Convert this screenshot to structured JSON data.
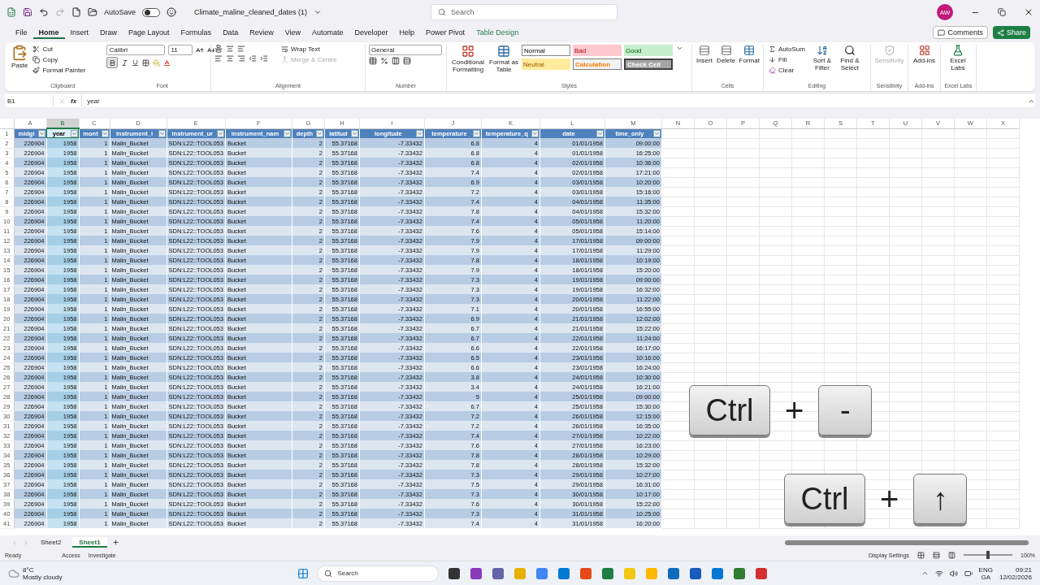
{
  "titlebar": {
    "autosave_label": "AutoSave",
    "autosave_on": false,
    "filename": "Climate_maline_cleaned_dates (1)",
    "search_placeholder": "Search",
    "avatar": "AW"
  },
  "menu_tabs": [
    {
      "label": "File",
      "selected": false,
      "kind": "normal"
    },
    {
      "label": "Home",
      "selected": true,
      "kind": "normal"
    },
    {
      "label": "Insert",
      "selected": false,
      "kind": "normal"
    },
    {
      "label": "Draw",
      "selected": false,
      "kind": "normal"
    },
    {
      "label": "Page Layout",
      "selected": false,
      "kind": "normal"
    },
    {
      "label": "Formulas",
      "selected": false,
      "kind": "normal"
    },
    {
      "label": "Data",
      "selected": false,
      "kind": "normal"
    },
    {
      "label": "Review",
      "selected": false,
      "kind": "normal"
    },
    {
      "label": "View",
      "selected": false,
      "kind": "normal"
    },
    {
      "label": "Automate",
      "selected": false,
      "kind": "normal"
    },
    {
      "label": "Developer",
      "selected": false,
      "kind": "normal"
    },
    {
      "label": "Help",
      "selected": false,
      "kind": "normal"
    },
    {
      "label": "Power Pivot",
      "selected": false,
      "kind": "normal"
    },
    {
      "label": "Table Design",
      "selected": false,
      "kind": "contextual"
    }
  ],
  "comments": "Comments",
  "share": "Share",
  "ribbon": {
    "clipboard": {
      "paste": "Paste",
      "cut": "Cut",
      "copy": "Copy",
      "format_painter": "Format Painter",
      "title": "Clipboard"
    },
    "font": {
      "name": "Calibri",
      "size": "11",
      "bold_on": true,
      "title": "Font"
    },
    "alignment": {
      "wrap": "Wrap Text",
      "merge": "Merge & Centre",
      "title": "Alignment"
    },
    "number": {
      "format": "General",
      "title": "Number"
    },
    "styles": {
      "conditional": "Conditional Formatting",
      "format_table": "Format as Table",
      "cells": [
        {
          "label": "Normal",
          "kind": "normal"
        },
        {
          "label": "Bad",
          "kind": "bad"
        },
        {
          "label": "Good",
          "kind": "good"
        },
        {
          "label": "Neutral",
          "kind": "neutral"
        },
        {
          "label": "Calculation",
          "kind": "calculation"
        },
        {
          "label": "Check Cell",
          "kind": "check"
        }
      ],
      "title": "Styles"
    },
    "cells": {
      "insert": "Insert",
      "delete": "Delete",
      "format": "Format",
      "title": "Cells"
    },
    "editing": {
      "autosum": "AutoSum",
      "fill": "Fill",
      "clear": "Clear",
      "sort": "Sort & Filter",
      "find": "Find & Select",
      "title": "Editing"
    },
    "sensitivity": {
      "label": "Sensitivity",
      "title": "Sensitivity"
    },
    "addins": {
      "label": "Add-ins",
      "title": "Add-ins"
    },
    "labs": {
      "label": "Excel Labs",
      "title": "Excel Labs"
    }
  },
  "formula_bar": {
    "cell": "B1",
    "fx": "fx",
    "value": "year"
  },
  "sheet": {
    "corner_row": "1",
    "columns": [
      {
        "label": "A",
        "selected": false
      },
      {
        "label": "B",
        "selected": true
      },
      {
        "label": "C",
        "selected": false
      },
      {
        "label": "D",
        "selected": false
      },
      {
        "label": "E",
        "selected": false
      },
      {
        "label": "F",
        "selected": false
      },
      {
        "label": "G",
        "selected": false
      },
      {
        "label": "H",
        "selected": false
      },
      {
        "label": "I",
        "selected": false
      },
      {
        "label": "J",
        "selected": false
      },
      {
        "label": "K",
        "selected": false
      },
      {
        "label": "L",
        "selected": false
      },
      {
        "label": "M",
        "selected": false
      },
      {
        "label": "N",
        "selected": false
      },
      {
        "label": "O",
        "selected": false
      },
      {
        "label": "P",
        "selected": false
      },
      {
        "label": "Q",
        "selected": false
      },
      {
        "label": "R",
        "selected": false
      },
      {
        "label": "S",
        "selected": false
      },
      {
        "label": "T",
        "selected": false
      },
      {
        "label": "U",
        "selected": false
      },
      {
        "label": "V",
        "selected": false
      },
      {
        "label": "W",
        "selected": false
      },
      {
        "label": "X",
        "selected": false
      }
    ],
    "headers": [
      "midgi",
      "year",
      "mont",
      "instrument_i",
      "instrument_ur",
      "instrument_nam",
      "depth",
      "latitud",
      "longitude",
      "temperature",
      "temperature_q",
      "date",
      "time_only"
    ],
    "rows": [
      {
        "n": "2",
        "cells": [
          "226904",
          "1958",
          "1",
          "Malin_Bucket",
          "SDN:L22::TOOL053",
          "Bucket",
          "2",
          "55.37168",
          "-7.33432",
          "6.8",
          "4",
          "01/01/1958",
          "09:00:00"
        ]
      },
      {
        "n": "3",
        "cells": [
          "226904",
          "1958",
          "1",
          "Malin_Bucket",
          "SDN:L22::TOOL053",
          "Bucket",
          "2",
          "55.37168",
          "-7.33432",
          "6.8",
          "4",
          "01/01/1958",
          "16:25:00"
        ]
      },
      {
        "n": "4",
        "cells": [
          "226904",
          "1958",
          "1",
          "Malin_Bucket",
          "SDN:L22::TOOL053",
          "Bucket",
          "2",
          "55.37168",
          "-7.33432",
          "6.8",
          "4",
          "02/01/1958",
          "10:36:00"
        ]
      },
      {
        "n": "5",
        "cells": [
          "226904",
          "1958",
          "1",
          "Malin_Bucket",
          "SDN:L22::TOOL053",
          "Bucket",
          "2",
          "55.37168",
          "-7.33432",
          "7.4",
          "4",
          "02/01/1958",
          "17:21:00"
        ]
      },
      {
        "n": "6",
        "cells": [
          "226904",
          "1958",
          "1",
          "Malin_Bucket",
          "SDN:L22::TOOL053",
          "Bucket",
          "2",
          "55.37168",
          "-7.33432",
          "6.9",
          "4",
          "03/01/1958",
          "10:20:00"
        ]
      },
      {
        "n": "7",
        "cells": [
          "226904",
          "1958",
          "1",
          "Malin_Bucket",
          "SDN:L22::TOOL053",
          "Bucket",
          "2",
          "55.37168",
          "-7.33432",
          "7.2",
          "4",
          "03/01/1958",
          "15:16:00"
        ]
      },
      {
        "n": "8",
        "cells": [
          "226904",
          "1958",
          "1",
          "Malin_Bucket",
          "SDN:L22::TOOL053",
          "Bucket",
          "2",
          "55.37168",
          "-7.33432",
          "7.4",
          "4",
          "04/01/1958",
          "11:35:00"
        ]
      },
      {
        "n": "9",
        "cells": [
          "226904",
          "1958",
          "1",
          "Malin_Bucket",
          "SDN:L22::TOOL053",
          "Bucket",
          "2",
          "55.37168",
          "-7.33432",
          "7.8",
          "4",
          "04/01/1958",
          "15:32:00"
        ]
      },
      {
        "n": "10",
        "cells": [
          "226904",
          "1958",
          "1",
          "Malin_Bucket",
          "SDN:L22::TOOL053",
          "Bucket",
          "2",
          "55.37168",
          "-7.33432",
          "7.4",
          "4",
          "05/01/1958",
          "11:20:00"
        ]
      },
      {
        "n": "11",
        "cells": [
          "226904",
          "1958",
          "1",
          "Malin_Bucket",
          "SDN:L22::TOOL053",
          "Bucket",
          "2",
          "55.37168",
          "-7.33432",
          "7.6",
          "4",
          "05/01/1958",
          "15:14:00"
        ]
      },
      {
        "n": "12",
        "cells": [
          "226904",
          "1958",
          "1",
          "Malin_Bucket",
          "SDN:L22::TOOL053",
          "Bucket",
          "2",
          "55.37168",
          "-7.33432",
          "7.9",
          "4",
          "17/01/1958",
          "09:00:00"
        ]
      },
      {
        "n": "13",
        "cells": [
          "226904",
          "1958",
          "1",
          "Malin_Bucket",
          "SDN:L22::TOOL053",
          "Bucket",
          "2",
          "55.37168",
          "-7.33432",
          "7.9",
          "4",
          "17/01/1958",
          "11:29:00"
        ]
      },
      {
        "n": "14",
        "cells": [
          "226904",
          "1958",
          "1",
          "Malin_Bucket",
          "SDN:L22::TOOL053",
          "Bucket",
          "2",
          "55.37168",
          "-7.33432",
          "7.8",
          "4",
          "18/01/1958",
          "10:19:00"
        ]
      },
      {
        "n": "15",
        "cells": [
          "226904",
          "1958",
          "1",
          "Malin_Bucket",
          "SDN:L22::TOOL053",
          "Bucket",
          "2",
          "55.37168",
          "-7.33432",
          "7.9",
          "4",
          "18/01/1958",
          "15:20:00"
        ]
      },
      {
        "n": "16",
        "cells": [
          "226904",
          "1958",
          "1",
          "Malin_Bucket",
          "SDN:L22::TOOL053",
          "Bucket",
          "2",
          "55.37168",
          "-7.33432",
          "7.3",
          "4",
          "19/01/1958",
          "09:00:00"
        ]
      },
      {
        "n": "17",
        "cells": [
          "226904",
          "1958",
          "1",
          "Malin_Bucket",
          "SDN:L22::TOOL053",
          "Bucket",
          "2",
          "55.37168",
          "-7.33432",
          "7.3",
          "4",
          "19/01/1958",
          "16:32:00"
        ]
      },
      {
        "n": "18",
        "cells": [
          "226904",
          "1958",
          "1",
          "Malin_Bucket",
          "SDN:L22::TOOL053",
          "Bucket",
          "2",
          "55.37168",
          "-7.33432",
          "7.3",
          "4",
          "20/01/1958",
          "11:22:00"
        ]
      },
      {
        "n": "19",
        "cells": [
          "226904",
          "1958",
          "1",
          "Malin_Bucket",
          "SDN:L22::TOOL053",
          "Bucket",
          "2",
          "55.37168",
          "-7.33432",
          "7.1",
          "4",
          "20/01/1958",
          "16:55:00"
        ]
      },
      {
        "n": "20",
        "cells": [
          "226904",
          "1958",
          "1",
          "Malin_Bucket",
          "SDN:L22::TOOL053",
          "Bucket",
          "2",
          "55.37168",
          "-7.33432",
          "6.9",
          "4",
          "21/01/1958",
          "12:02:00"
        ]
      },
      {
        "n": "21",
        "cells": [
          "226904",
          "1958",
          "1",
          "Malin_Bucket",
          "SDN:L22::TOOL053",
          "Bucket",
          "2",
          "55.37168",
          "-7.33432",
          "6.7",
          "4",
          "21/01/1958",
          "15:22:00"
        ]
      },
      {
        "n": "22",
        "cells": [
          "226904",
          "1958",
          "1",
          "Malin_Bucket",
          "SDN:L22::TOOL053",
          "Bucket",
          "2",
          "55.37168",
          "-7.33432",
          "6.7",
          "4",
          "22/01/1958",
          "11:24:00"
        ]
      },
      {
        "n": "23",
        "cells": [
          "226904",
          "1958",
          "1",
          "Malin_Bucket",
          "SDN:L22::TOOL053",
          "Bucket",
          "2",
          "55.37168",
          "-7.33432",
          "6.6",
          "4",
          "22/01/1958",
          "16:17:00"
        ]
      },
      {
        "n": "24",
        "cells": [
          "226904",
          "1958",
          "1",
          "Malin_Bucket",
          "SDN:L22::TOOL053",
          "Bucket",
          "2",
          "55.37168",
          "-7.33432",
          "6.5",
          "4",
          "23/01/1958",
          "10:16:00"
        ]
      },
      {
        "n": "25",
        "cells": [
          "226904",
          "1958",
          "1",
          "Malin_Bucket",
          "SDN:L22::TOOL053",
          "Bucket",
          "2",
          "55.37168",
          "-7.33432",
          "6.6",
          "4",
          "23/01/1958",
          "16:24:00"
        ]
      },
      {
        "n": "26",
        "cells": [
          "226904",
          "1958",
          "1",
          "Malin_Bucket",
          "SDN:L22::TOOL053",
          "Bucket",
          "2",
          "55.37168",
          "-7.33432",
          "3.8",
          "4",
          "24/01/1958",
          "10:30:00"
        ]
      },
      {
        "n": "27",
        "cells": [
          "226904",
          "1958",
          "1",
          "Malin_Bucket",
          "SDN:L22::TOOL053",
          "Bucket",
          "2",
          "55.37168",
          "-7.33432",
          "3.4",
          "4",
          "24/01/1958",
          "16:21:00"
        ]
      },
      {
        "n": "28",
        "cells": [
          "226904",
          "1958",
          "1",
          "Malin_Bucket",
          "SDN:L22::TOOL053",
          "Bucket",
          "2",
          "55.37168",
          "-7.33432",
          "5",
          "4",
          "25/01/1958",
          "09:00:00"
        ]
      },
      {
        "n": "29",
        "cells": [
          "226904",
          "1958",
          "1",
          "Malin_Bucket",
          "SDN:L22::TOOL053",
          "Bucket",
          "2",
          "55.37168",
          "-7.33432",
          "6.7",
          "4",
          "25/01/1958",
          "15:30:00"
        ]
      },
      {
        "n": "30",
        "cells": [
          "226904",
          "1958",
          "1",
          "Malin_Bucket",
          "SDN:L22::TOOL053",
          "Bucket",
          "2",
          "55.37168",
          "-7.33432",
          "7.2",
          "4",
          "26/01/1958",
          "12:15:00"
        ]
      },
      {
        "n": "31",
        "cells": [
          "226904",
          "1958",
          "1",
          "Malin_Bucket",
          "SDN:L22::TOOL053",
          "Bucket",
          "2",
          "55.37168",
          "-7.33432",
          "7.2",
          "4",
          "26/01/1958",
          "16:35:00"
        ]
      },
      {
        "n": "32",
        "cells": [
          "226904",
          "1958",
          "1",
          "Malin_Bucket",
          "SDN:L22::TOOL053",
          "Bucket",
          "2",
          "55.37168",
          "-7.33432",
          "7.4",
          "4",
          "27/01/1958",
          "10:22:00"
        ]
      },
      {
        "n": "33",
        "cells": [
          "226904",
          "1958",
          "1",
          "Malin_Bucket",
          "SDN:L22::TOOL053",
          "Bucket",
          "2",
          "55.37168",
          "-7.33432",
          "7.6",
          "4",
          "27/01/1958",
          "16:23:00"
        ]
      },
      {
        "n": "34",
        "cells": [
          "226904",
          "1958",
          "1",
          "Malin_Bucket",
          "SDN:L22::TOOL053",
          "Bucket",
          "2",
          "55.37168",
          "-7.33432",
          "7.8",
          "4",
          "28/01/1958",
          "10:29:00"
        ]
      },
      {
        "n": "35",
        "cells": [
          "226904",
          "1958",
          "1",
          "Malin_Bucket",
          "SDN:L22::TOOL053",
          "Bucket",
          "2",
          "55.37168",
          "-7.33432",
          "7.8",
          "4",
          "28/01/1958",
          "15:32:00"
        ]
      },
      {
        "n": "36",
        "cells": [
          "226904",
          "1958",
          "1",
          "Malin_Bucket",
          "SDN:L22::TOOL053",
          "Bucket",
          "2",
          "55.37168",
          "-7.33432",
          "7.3",
          "4",
          "29/01/1958",
          "10:27:00"
        ]
      },
      {
        "n": "37",
        "cells": [
          "226904",
          "1958",
          "1",
          "Malin_Bucket",
          "SDN:L22::TOOL053",
          "Bucket",
          "2",
          "55.37168",
          "-7.33432",
          "7.5",
          "4",
          "29/01/1958",
          "16:31:00"
        ]
      },
      {
        "n": "38",
        "cells": [
          "226904",
          "1958",
          "1",
          "Malin_Bucket",
          "SDN:L22::TOOL053",
          "Bucket",
          "2",
          "55.37168",
          "-7.33432",
          "7.3",
          "4",
          "30/01/1958",
          "10:17:00"
        ]
      },
      {
        "n": "39",
        "cells": [
          "226904",
          "1958",
          "1",
          "Malin_Bucket",
          "SDN:L22::TOOL053",
          "Bucket",
          "2",
          "55.37168",
          "-7.33432",
          "7.6",
          "4",
          "30/01/1958",
          "15:22:00"
        ]
      },
      {
        "n": "40",
        "cells": [
          "226904",
          "1958",
          "1",
          "Malin_Bucket",
          "SDN:L22::TOOL053",
          "Bucket",
          "2",
          "55.37168",
          "-7.33432",
          "7.3",
          "4",
          "31/01/1958",
          "10:25:00"
        ]
      },
      {
        "n": "41",
        "cells": [
          "226904",
          "1958",
          "1",
          "Malin_Bucket",
          "SDN:L22::TOOL053",
          "Bucket",
          "2",
          "55.37168",
          "-7.33432",
          "7.4",
          "4",
          "31/01/1958",
          "16:20:00"
        ]
      }
    ]
  },
  "shortcuts": [
    {
      "keys": [
        "Ctrl",
        "-"
      ],
      "joiner": "+"
    },
    {
      "keys": [
        "Ctrl",
        "↑"
      ],
      "joiner": "+"
    }
  ],
  "sheet_tabs": [
    {
      "label": "Sheet2",
      "selected": false
    },
    {
      "label": "Sheet1",
      "selected": true
    }
  ],
  "status": {
    "ready": "Ready",
    "accessibility": "Access",
    "investigate": "Investigate",
    "display": "Display Settings",
    "zoom": "100%",
    "level": 0.5
  },
  "taskbar": {
    "temp": "8°C",
    "weather": "Mostly cloudy",
    "search": "Search",
    "lang1": "ENG",
    "lang2": "GA",
    "time": "09:21",
    "date": "12/02/2026"
  }
}
